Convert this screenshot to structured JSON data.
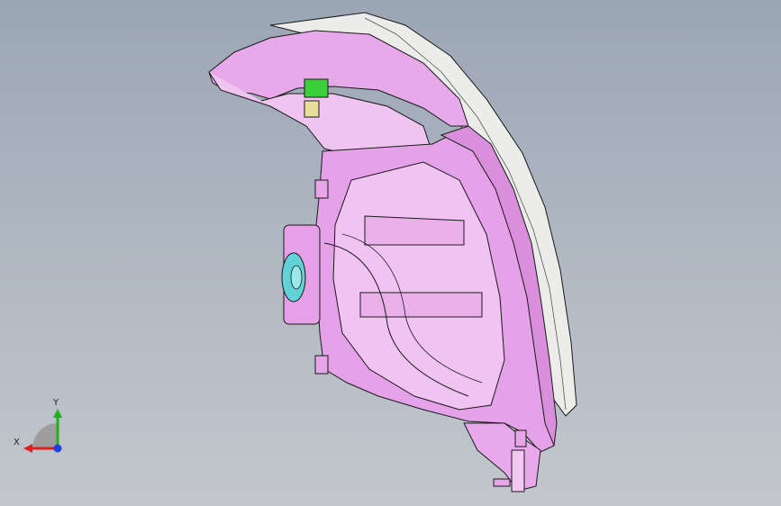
{
  "viewport": {
    "part": "headlamp-assembly",
    "colors": {
      "housing": "#e6a6e8",
      "housing_light": "#f3cbf3",
      "housing_dark": "#b063b8",
      "lens": "#e9e9e6",
      "edge": "#1a1a1a",
      "bulb_socket": "#5fd0d6",
      "connector_green": "#3ccf3c",
      "connector_yellow": "#e8e09a"
    }
  },
  "triad": {
    "x_label": "X",
    "y_label": "Y",
    "x_color": "#e02020",
    "y_color": "#20b020",
    "z_color": "#2040e0"
  }
}
